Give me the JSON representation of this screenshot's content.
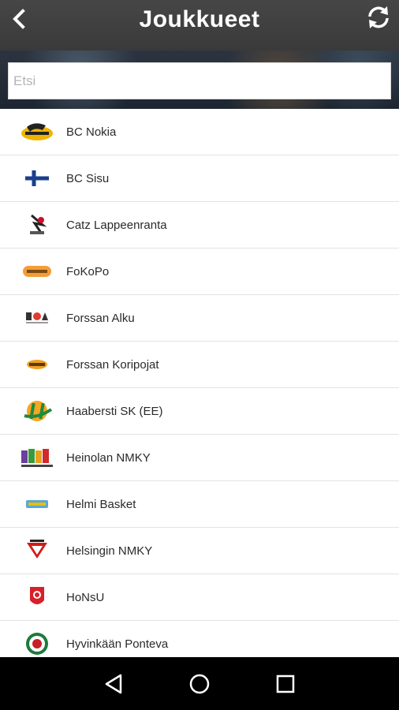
{
  "header": {
    "title": "Joukkueet",
    "back_icon": "back-arrow-icon",
    "refresh_icon": "refresh-icon"
  },
  "search": {
    "placeholder": "Etsi",
    "value": ""
  },
  "teams": [
    {
      "name": "BC Nokia",
      "logo_icon": "bc-nokia-logo"
    },
    {
      "name": "BC Sisu",
      "logo_icon": "finland-flag-logo"
    },
    {
      "name": "Catz Lappeenranta",
      "logo_icon": "catz-logo"
    },
    {
      "name": "FoKoPo",
      "logo_icon": "fokopo-logo"
    },
    {
      "name": "Forssan Alku",
      "logo_icon": "forssan-alku-logo"
    },
    {
      "name": "Forssan Koripojat",
      "logo_icon": "forssan-koripojat-logo"
    },
    {
      "name": "Haabersti SK (EE)",
      "logo_icon": "haabersti-logo"
    },
    {
      "name": "Heinolan NMKY",
      "logo_icon": "heinolan-nmky-logo"
    },
    {
      "name": "Helmi Basket",
      "logo_icon": "helmi-basket-logo"
    },
    {
      "name": "Helsingin NMKY",
      "logo_icon": "helsingin-nmky-logo"
    },
    {
      "name": "HoNsU",
      "logo_icon": "honsu-logo"
    },
    {
      "name": "Hyvinkään Ponteva",
      "logo_icon": "ponteva-logo"
    }
  ],
  "navbar": {
    "back_icon": "nav-back-icon",
    "home_icon": "nav-home-icon",
    "recents_icon": "nav-recents-icon"
  },
  "colors": {
    "header_bg": "#3f3f3f",
    "text": "#2a2a2a",
    "navbar_bg": "#000000"
  }
}
